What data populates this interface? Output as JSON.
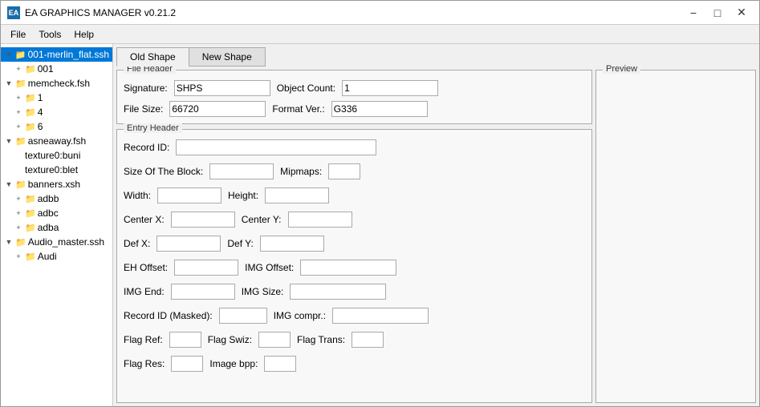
{
  "window": {
    "title": "EA GRAPHICS MANAGER v0.21.2",
    "icon": "EA"
  },
  "menu": {
    "items": [
      "File",
      "Tools",
      "Help"
    ]
  },
  "sidebar": {
    "items": [
      {
        "id": "001-merlin-flat",
        "label": "001-merlin_flat.ssh",
        "level": 0,
        "expanded": true,
        "selected": true,
        "hasIcon": true
      },
      {
        "id": "001",
        "label": "001",
        "level": 1,
        "expanded": false,
        "hasIcon": true
      },
      {
        "id": "memcheck",
        "label": "memcheck.fsh",
        "level": 0,
        "expanded": true,
        "hasIcon": true
      },
      {
        "id": "1",
        "label": "1",
        "level": 1,
        "expanded": false,
        "hasIcon": true
      },
      {
        "id": "4",
        "label": "4",
        "level": 1,
        "expanded": false,
        "hasIcon": true
      },
      {
        "id": "6",
        "label": "6",
        "level": 1,
        "expanded": false,
        "hasIcon": true
      },
      {
        "id": "asneaway",
        "label": "asneaway.fsh",
        "level": 0,
        "expanded": true,
        "hasIcon": true
      },
      {
        "id": "texture0buni",
        "label": "texture0:buni",
        "level": 1,
        "expanded": false,
        "hasIcon": false
      },
      {
        "id": "texture0blet",
        "label": "texture0:blet",
        "level": 1,
        "expanded": false,
        "hasIcon": false
      },
      {
        "id": "banners",
        "label": "banners.xsh",
        "level": 0,
        "expanded": true,
        "hasIcon": true
      },
      {
        "id": "adbb",
        "label": "adbb",
        "level": 1,
        "expanded": false,
        "hasIcon": true
      },
      {
        "id": "adbc",
        "label": "adbc",
        "level": 1,
        "expanded": false,
        "hasIcon": true
      },
      {
        "id": "adba",
        "label": "adba",
        "level": 1,
        "expanded": false,
        "hasIcon": true
      },
      {
        "id": "audio-master",
        "label": "Audio_master.ssh",
        "level": 0,
        "expanded": true,
        "hasIcon": true
      },
      {
        "id": "audi",
        "label": "Audi",
        "level": 1,
        "expanded": false,
        "hasIcon": true
      }
    ]
  },
  "tabs": [
    {
      "id": "old-shape",
      "label": "Old Shape",
      "active": true
    },
    {
      "id": "new-shape",
      "label": "New Shape",
      "active": false
    }
  ],
  "file_header": {
    "title": "File Header",
    "signature_label": "Signature:",
    "signature_value": "SHPS",
    "object_count_label": "Object Count:",
    "object_count_value": "1",
    "file_size_label": "File Size:",
    "file_size_value": "66720",
    "format_ver_label": "Format Ver.:",
    "format_ver_value": "G336"
  },
  "entry_header": {
    "title": "Entry Header",
    "record_id_label": "Record ID:",
    "record_id_value": "",
    "size_block_label": "Size Of The Block:",
    "size_block_value": "",
    "mipmaps_label": "Mipmaps:",
    "mipmaps_value": "",
    "width_label": "Width:",
    "width_value": "",
    "height_label": "Height:",
    "height_value": "",
    "center_x_label": "Center X:",
    "center_x_value": "",
    "center_y_label": "Center Y:",
    "center_y_value": "",
    "def_x_label": "Def X:",
    "def_x_value": "",
    "def_y_label": "Def Y:",
    "def_y_value": "",
    "eh_offset_label": "EH Offset:",
    "eh_offset_value": "",
    "img_offset_label": "IMG Offset:",
    "img_offset_value": "",
    "img_end_label": "IMG End:",
    "img_end_value": "",
    "img_size_label": "IMG Size:",
    "img_size_value": "",
    "record_id_masked_label": "Record ID (Masked):",
    "record_id_masked_value": "",
    "img_compr_label": "IMG compr.:",
    "img_compr_value": "",
    "flag_ref_label": "Flag Ref:",
    "flag_ref_value": "",
    "flag_swiz_label": "Flag Swiz:",
    "flag_swiz_value": "",
    "flag_trans_label": "Flag Trans:",
    "flag_trans_value": "",
    "flag_res_label": "Flag Res:",
    "flag_res_value": "",
    "image_bpp_label": "Image bpp:",
    "image_bpp_value": ""
  },
  "preview": {
    "title": "Preview"
  }
}
